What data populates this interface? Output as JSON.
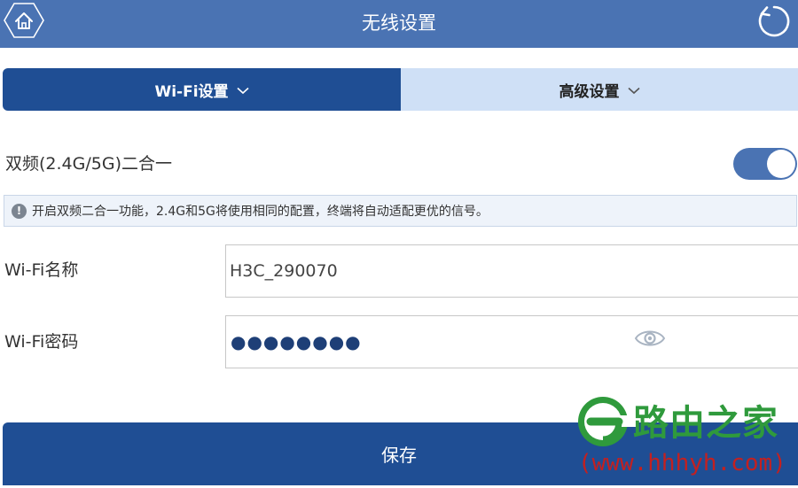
{
  "header": {
    "title": "无线设置",
    "home_icon": "home-icon",
    "refresh_icon": "refresh-icon",
    "bar_color": "#4a73b3"
  },
  "tabs": [
    {
      "label": "Wi-Fi设置",
      "active": true,
      "icon": "chevron-down-icon"
    },
    {
      "label": "高级设置",
      "active": false,
      "icon": "chevron-down-icon"
    }
  ],
  "dual_band": {
    "label": "双频(2.4G/5G)二合一",
    "enabled": true
  },
  "notice": {
    "icon": "info-icon",
    "text": "开启双频二合一功能，2.4G和5G将使用相同的配置，终端将自动适配更优的信号。"
  },
  "wifi_name": {
    "label": "Wi-Fi名称",
    "value": "H3C_290070"
  },
  "wifi_password": {
    "label": "Wi-Fi密码",
    "masked_value": "●●●●●●●●",
    "reveal_icon": "eye-icon"
  },
  "save_button": {
    "label": "保存"
  },
  "watermark": {
    "brand": "路由之家",
    "url": "(www.hhhyh.com)"
  },
  "colors": {
    "primary": "#1f4e94",
    "header": "#4a73b3",
    "tab_inactive": "#cfe0f6",
    "watermark_green": "#2f9a3c",
    "watermark_red": "#c32020"
  }
}
